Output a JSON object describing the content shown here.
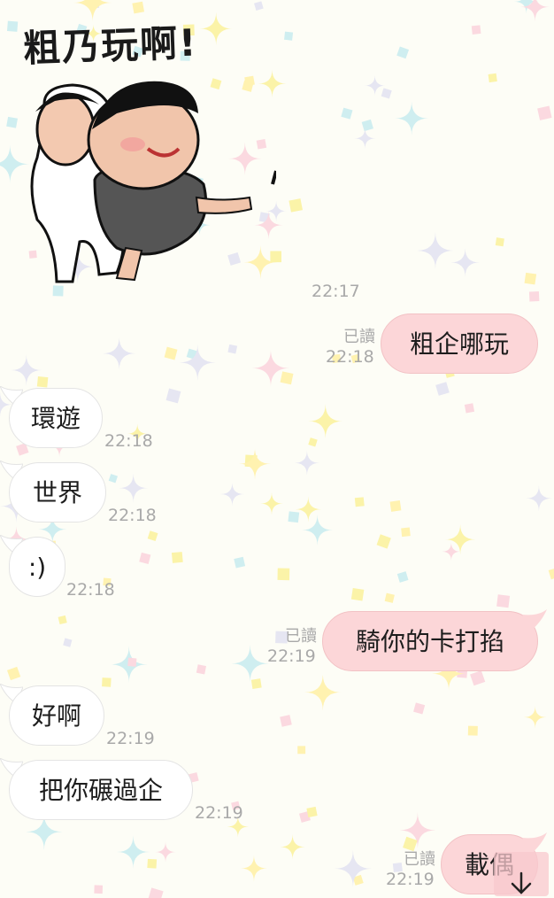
{
  "sticker": {
    "caption": "粗乃玩啊!",
    "time": "22:17"
  },
  "messages": [
    {
      "dir": "out",
      "text": "粗企哪玩",
      "read": "已讀",
      "time": "22:18"
    },
    {
      "dir": "in",
      "text": "環遊",
      "time": "22:18"
    },
    {
      "dir": "in",
      "text": "世界",
      "time": "22:18"
    },
    {
      "dir": "in",
      "text": ":)",
      "time": "22:18"
    },
    {
      "dir": "out",
      "text": "騎你的卡打掐",
      "read": "已讀",
      "time": "22:19"
    },
    {
      "dir": "in",
      "text": "好啊",
      "time": "22:19"
    },
    {
      "dir": "in",
      "text": "把你碾過企",
      "time": "22:19"
    },
    {
      "dir": "out",
      "text": "載偶",
      "read": "已讀",
      "time": "22:19"
    }
  ],
  "colors": {
    "outgoing_bubble": "#fcd6d8",
    "incoming_bubble": "#ffffff",
    "meta_text": "#a9a9a9"
  },
  "icons": {
    "scroll_down": "arrow-down-icon"
  }
}
